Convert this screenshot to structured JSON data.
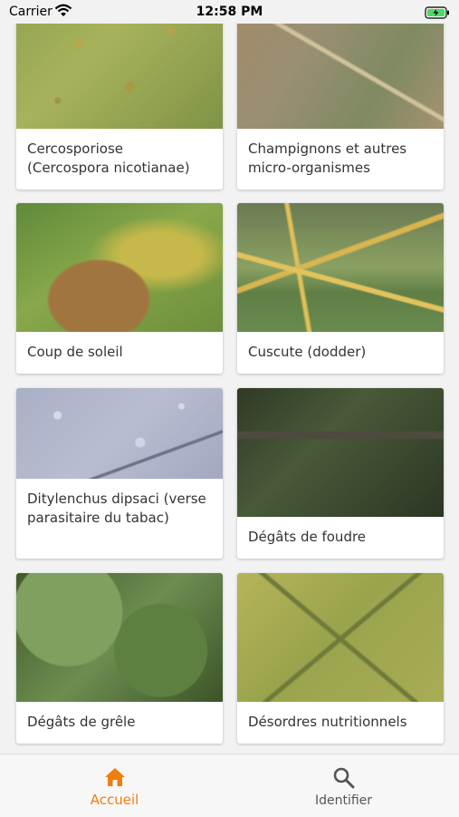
{
  "status_bar": {
    "carrier": "Carrier",
    "time": "12:58 PM"
  },
  "cards": [
    {
      "label": "Cercosporiose\n(Cercospora nicotianae)"
    },
    {
      "label": "Champignons et autres micro-organismes"
    },
    {
      "label": "Coup de soleil"
    },
    {
      "label": "Cuscute (dodder)"
    },
    {
      "label": "Ditylenchus dipsaci (verse parasitaire du tabac)"
    },
    {
      "label": "Dégâts de foudre"
    },
    {
      "label": "Dégâts de grêle"
    },
    {
      "label": "Désordres nutritionnels"
    }
  ],
  "tab_bar": {
    "home_label": "Accueil",
    "identify_label": "Identifier",
    "active_color": "#f07e0e",
    "inactive_color": "#555555"
  },
  "icons": {
    "wifi": "wifi-icon",
    "battery": "battery-charging-icon",
    "home": "home-icon",
    "search": "search-icon"
  }
}
